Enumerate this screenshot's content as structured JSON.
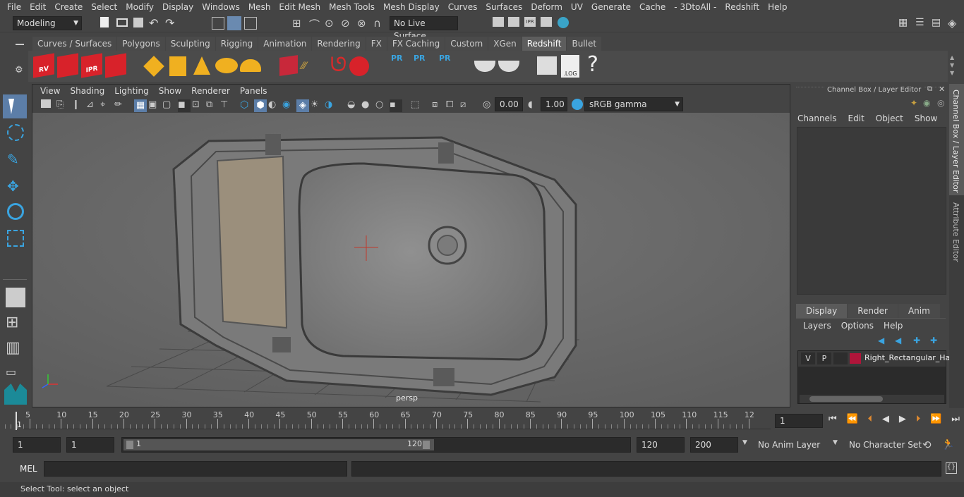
{
  "menu": [
    "File",
    "Edit",
    "Create",
    "Select",
    "Modify",
    "Display",
    "Windows",
    "Mesh",
    "Edit Mesh",
    "Mesh Tools",
    "Mesh Display",
    "Curves",
    "Surfaces",
    "Deform",
    "UV",
    "Generate",
    "Cache",
    "- 3DtoAll -",
    "Redshift",
    "Help"
  ],
  "status": {
    "mode": "Modeling",
    "live_surface": "No Live Surface"
  },
  "shelf_tabs": [
    "Curves / Surfaces",
    "Polygons",
    "Sculpting",
    "Rigging",
    "Animation",
    "Rendering",
    "FX",
    "FX Caching",
    "Custom",
    "XGen",
    "Redshift",
    "Bullet"
  ],
  "shelf_active": "Redshift",
  "shelf_labels": {
    "rv": "RV",
    "ipr": "IPR",
    "pr": "PR",
    "log": ".LOG",
    "help": "?"
  },
  "panel_menu": [
    "View",
    "Shading",
    "Lighting",
    "Show",
    "Renderer",
    "Panels"
  ],
  "panel_tools": {
    "exposure": "0.00",
    "gamma": "1.00",
    "colorspace": "sRGB gamma"
  },
  "viewport": {
    "camera": "persp"
  },
  "channel_box": {
    "title": "Channel Box / Layer Editor",
    "menu": [
      "Channels",
      "Edit",
      "Object",
      "Show"
    ]
  },
  "layer_editor": {
    "tabs": [
      "Display",
      "Render",
      "Anim"
    ],
    "menu": [
      "Layers",
      "Options",
      "Help"
    ],
    "layer": {
      "v": "V",
      "p": "P",
      "name": "Right_Rectangular_Ha",
      "color": "#b0153a"
    }
  },
  "side_tabs": [
    "Channel Box / Layer Editor",
    "Attribute Editor"
  ],
  "timeline": {
    "ticks": [
      "5",
      "10",
      "15",
      "20",
      "25",
      "30",
      "35",
      "40",
      "45",
      "50",
      "55",
      "60",
      "65",
      "70",
      "75",
      "80",
      "85",
      "90",
      "95",
      "100",
      "105",
      "110",
      "115",
      "12"
    ],
    "start_label": "1",
    "current": "1"
  },
  "range": {
    "start": "1",
    "playback_start": "1",
    "slider_start": "1",
    "slider_end": "120",
    "end": "120",
    "anim_end": "200",
    "anim_layer": "No Anim Layer",
    "char_set": "No Character Set"
  },
  "command": {
    "lang": "MEL"
  },
  "help_line": "Select Tool: select an object"
}
